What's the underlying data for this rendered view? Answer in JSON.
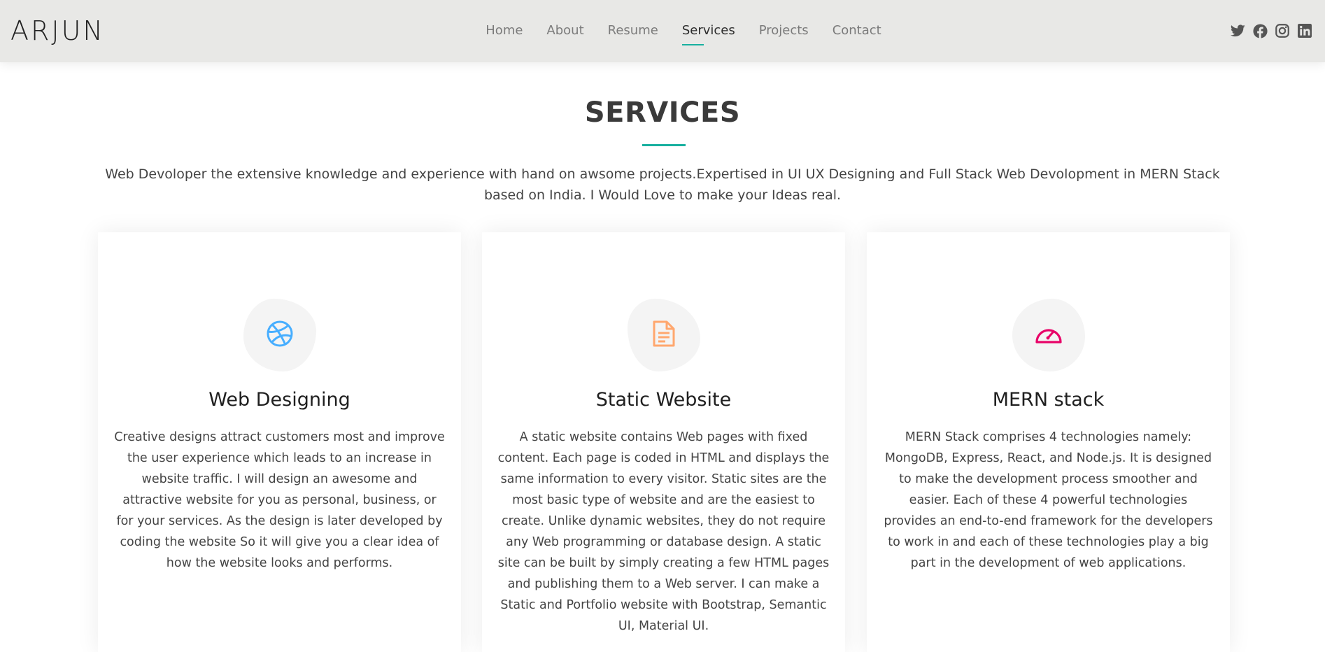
{
  "brand": {
    "logo": "ARJUN"
  },
  "nav": {
    "items": [
      "Home",
      "About",
      "Resume",
      "Services",
      "Projects",
      "Contact"
    ],
    "active": "Services",
    "accent_color": "#18b09f"
  },
  "social": {
    "icons": [
      "twitter-icon",
      "facebook-icon",
      "instagram-icon",
      "linkedin-icon"
    ]
  },
  "services": {
    "title": "SERVICES",
    "intro": "Web Devoloper the extensive knowledge and experience with hand on awsome projects.Expertised in UI UX Designing and Full Stack Web Devolopment in MERN Stack based on India. I Would Love to make your Ideas real.",
    "cards": [
      {
        "icon": "dribbble-icon",
        "icon_color": "#47aeff",
        "title": "Web Designing",
        "text": "Creative designs attract customers most and improve the user experience which leads to an increase in website traffic. I will design an awesome and attractive website for you as personal, business, or for your services. As the design is later developed by coding the website So it will give you a clear idea of how the website looks and performs."
      },
      {
        "icon": "document-icon",
        "icon_color": "#ffa76e",
        "title": "Static Website",
        "text": "A static website contains Web pages with fixed content. Each page is coded in HTML and displays the same information to every visitor. Static sites are the most basic type of website and are the easiest to create. Unlike dynamic websites, they do not require any Web programming or database design. A static site can be built by simply creating a few HTML pages and publishing them to a Web server. I can make a Static and Portfolio website with Bootstrap, Semantic UI, Material UI."
      },
      {
        "icon": "speedometer-icon",
        "icon_color": "#e80368",
        "title": "MERN stack",
        "text": "MERN Stack comprises 4 technologies namely: MongoDB, Express, React, and Node.js. It is designed to make the development process smoother and easier. Each of these 4 powerful technologies provides an end-to-end framework for the developers to work in and each of these technologies play a big part in the development of web applications."
      }
    ]
  }
}
